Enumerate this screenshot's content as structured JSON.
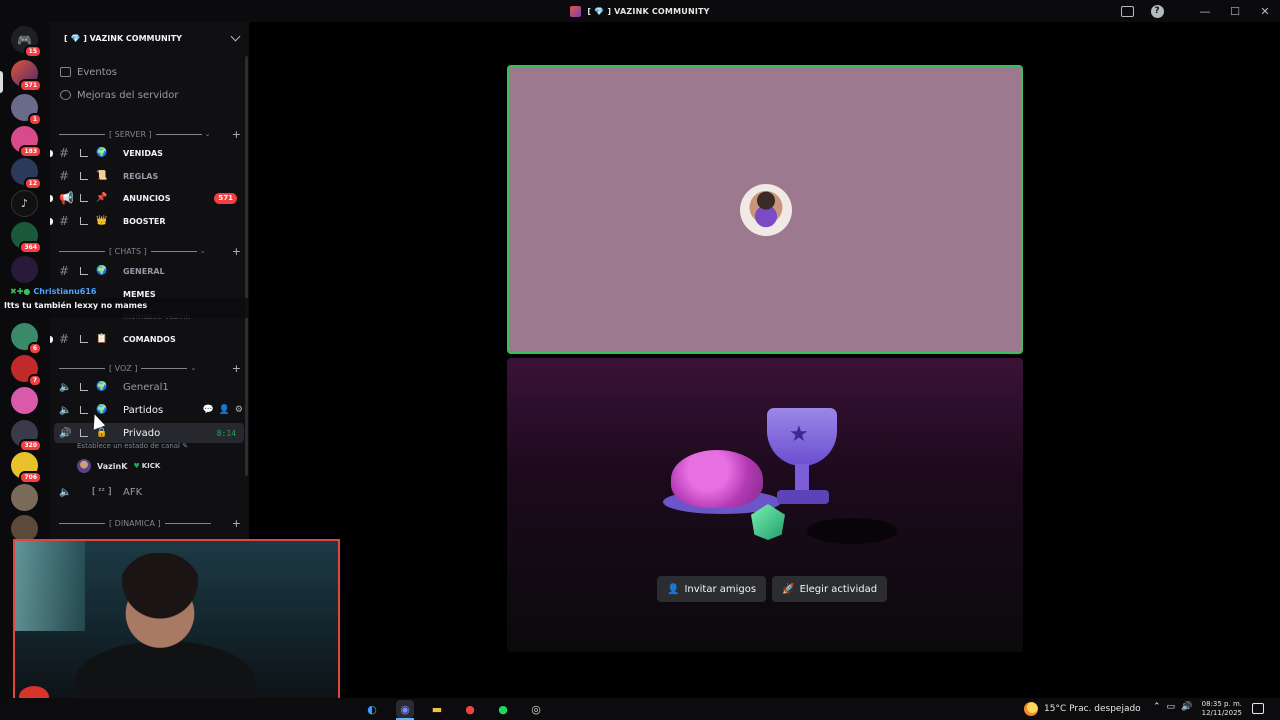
{
  "window": {
    "title": "[ 💎 ]  VAZINK COMMUNITY"
  },
  "rail": {
    "badges": [
      "15",
      "571",
      "1",
      "183",
      "12",
      "364",
      "6",
      "7",
      "320",
      "706"
    ]
  },
  "sidebar": {
    "server_name": "[ 💎 ]  VAZINK COMMUNITY",
    "events": "Eventos",
    "boosts": "Mejoras del servidor",
    "categories": {
      "server": "[ SERVER ]",
      "chats": "[ CHATS ]",
      "voz": "[ VOZ ]",
      "dinamica": "[ DINAMICA ]"
    },
    "channels": {
      "venidas": "VENIDAS",
      "reglas": "REGLAS",
      "anuncios": "ANUNCIOS",
      "anuncios_badge": "571",
      "booster": "BOOSTER",
      "general": "GENERAL",
      "memes": "MEMES",
      "momazos": "momazos-vazink",
      "comandos": "COMANDOS"
    },
    "voice": {
      "general1": "General1",
      "partidos": "Partidos",
      "privado": "Privado",
      "privado_timer": "8:14",
      "status_hint": "Establece un estado de canal",
      "user_name": "VazinK",
      "user_tag": "KICK",
      "afk": "AFK"
    }
  },
  "notification": {
    "author": "Christianu616",
    "message": "Itts tu también lexxy no mames"
  },
  "stage": {
    "buttons": {
      "invite": "Invitar amigos",
      "activity": "Elegir actividad"
    }
  },
  "taskbar": {
    "weather": "15°C  Prac. despejado",
    "time": "08:35 p. m.",
    "date": "12/11/2025"
  },
  "colors": {
    "tile_bg": "#9c798f",
    "speaking_border": "#3bbf5a",
    "mention_red": "#f23f42",
    "voice_green": "#23a55a",
    "webcam_border": "#e0453f"
  }
}
